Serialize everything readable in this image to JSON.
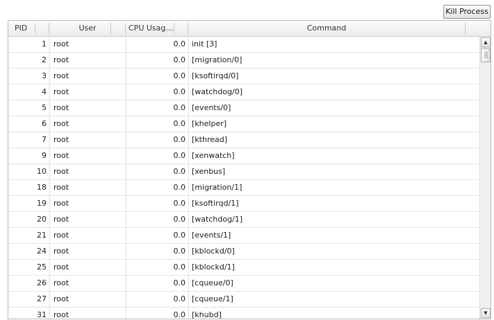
{
  "toolbar": {
    "kill_label": "Kill Process"
  },
  "table": {
    "columns": {
      "pid": "PID",
      "user": "User",
      "cpu": "CPU Usag...",
      "command": "Command"
    },
    "rows": [
      {
        "pid": "1",
        "user": "root",
        "cpu": "0.0",
        "command": "init [3]"
      },
      {
        "pid": "2",
        "user": "root",
        "cpu": "0.0",
        "command": "[migration/0]"
      },
      {
        "pid": "3",
        "user": "root",
        "cpu": "0.0",
        "command": "[ksoftirqd/0]"
      },
      {
        "pid": "4",
        "user": "root",
        "cpu": "0.0",
        "command": "[watchdog/0]"
      },
      {
        "pid": "5",
        "user": "root",
        "cpu": "0.0",
        "command": "[events/0]"
      },
      {
        "pid": "6",
        "user": "root",
        "cpu": "0.0",
        "command": "[khelper]"
      },
      {
        "pid": "7",
        "user": "root",
        "cpu": "0.0",
        "command": "[kthread]"
      },
      {
        "pid": "9",
        "user": "root",
        "cpu": "0.0",
        "command": "[xenwatch]"
      },
      {
        "pid": "10",
        "user": "root",
        "cpu": "0.0",
        "command": "[xenbus]"
      },
      {
        "pid": "18",
        "user": "root",
        "cpu": "0.0",
        "command": "[migration/1]"
      },
      {
        "pid": "19",
        "user": "root",
        "cpu": "0.0",
        "command": "[ksoftirqd/1]"
      },
      {
        "pid": "20",
        "user": "root",
        "cpu": "0.0",
        "command": "[watchdog/1]"
      },
      {
        "pid": "21",
        "user": "root",
        "cpu": "0.0",
        "command": "[events/1]"
      },
      {
        "pid": "24",
        "user": "root",
        "cpu": "0.0",
        "command": "[kblockd/0]"
      },
      {
        "pid": "25",
        "user": "root",
        "cpu": "0.0",
        "command": "[kblockd/1]"
      },
      {
        "pid": "26",
        "user": "root",
        "cpu": "0.0",
        "command": "[cqueue/0]"
      },
      {
        "pid": "27",
        "user": "root",
        "cpu": "0.0",
        "command": "[cqueue/1]"
      },
      {
        "pid": "31",
        "user": "root",
        "cpu": "0.0",
        "command": "[khubd]"
      }
    ]
  },
  "icons": {
    "scroll_up": "arrow-up-icon",
    "scroll_down": "arrow-down-icon"
  }
}
